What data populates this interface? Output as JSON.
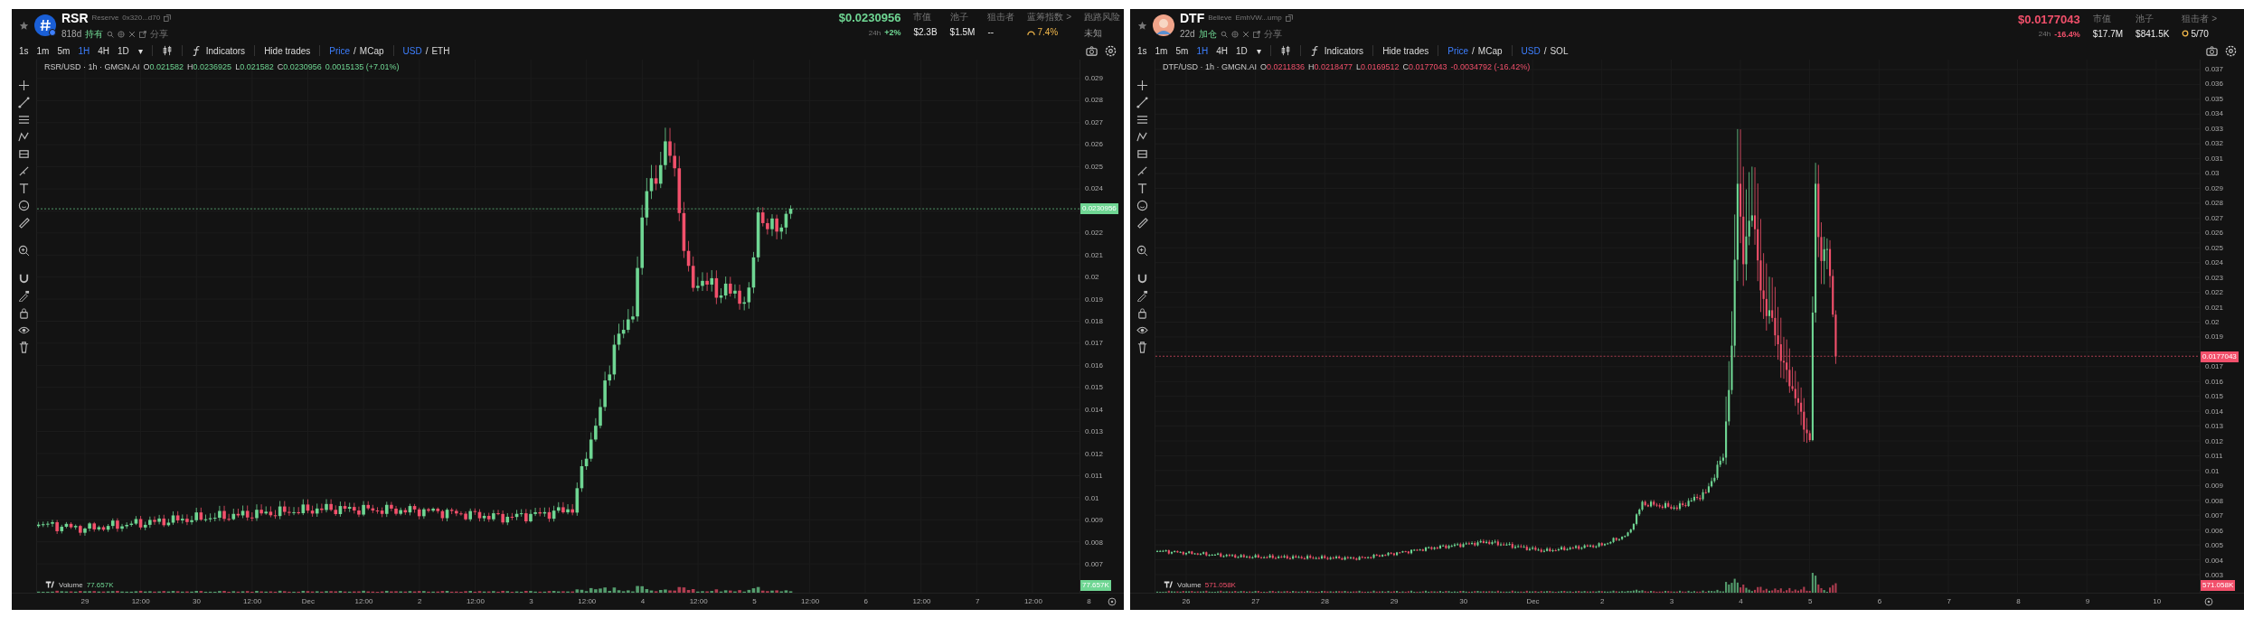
{
  "panels": [
    {
      "rising": true,
      "symbol": "RSR",
      "name": "Reserve",
      "address": "0x320...d70",
      "age": "818d",
      "holding": "持有",
      "share": "分享",
      "price": "$0.0230956",
      "change_label": "24h",
      "change": "+2%",
      "stats": [
        {
          "label": "市值",
          "value": "$2.3B"
        },
        {
          "label": "池子",
          "value": "$1.5M"
        },
        {
          "label": "狙击者",
          "value": "--"
        },
        {
          "label": "蓝筹指数 >",
          "value": "7.4%"
        },
        {
          "label": "跑路风险",
          "value": "未知"
        }
      ],
      "intervals": [
        {
          "label": "1s",
          "selected": false
        },
        {
          "label": "1m",
          "selected": false
        },
        {
          "label": "5m",
          "selected": false
        },
        {
          "label": "1H",
          "selected": true
        },
        {
          "label": "4H",
          "selected": false
        },
        {
          "label": "1D",
          "selected": false
        }
      ],
      "interval_more": "▾",
      "indicators": "Indicators",
      "hide_trades": "Hide trades",
      "price_mode": [
        {
          "label": "Price",
          "selected": true
        },
        {
          "label": "MCap",
          "selected": false
        }
      ],
      "price_divider": "/",
      "currency": [
        {
          "label": "USD",
          "selected": true
        },
        {
          "label": "ETH",
          "selected": false
        }
      ],
      "currency_divider": "/",
      "legend": {
        "title": "RSR/USD · 1h · GMGN.AI",
        "values": [
          {
            "label": "O",
            "value": "0.021582"
          },
          {
            "label": "H",
            "value": "0.0236925"
          },
          {
            "label": "L",
            "value": "0.021582"
          },
          {
            "label": "C",
            "value": "0.0230956"
          }
        ],
        "change": "0.0015135 (+7.01%)"
      },
      "y_ticks": [
        "0.029",
        "0.028",
        "0.027",
        "0.026",
        "0.025",
        "0.024",
        "0.022",
        "0.021",
        "0.02",
        "0.019",
        "0.018",
        "0.017",
        "0.016",
        "0.015",
        "0.014",
        "0.013",
        "0.012",
        "0.011",
        "0.01",
        "0.009",
        "0.008",
        "0.007"
      ],
      "price_tag": "0.0230956",
      "volume_label": "Volume",
      "volume": "77.657K",
      "volume_tag": "77.657K",
      "x_ticks": [
        "29",
        "12:00",
        "30",
        "12:00",
        "Dec",
        "12:00",
        "2",
        "12:00",
        "3",
        "12:00",
        "4",
        "12:00",
        "5",
        "12:00",
        "6",
        "12:00",
        "7",
        "12:00",
        "8"
      ]
    },
    {
      "rising": false,
      "symbol": "DTF",
      "name": "Believe",
      "address": "EmhVW...ump",
      "age": "22d",
      "holding": "加仓",
      "share": "分享",
      "price": "$0.0177043",
      "change_label": "24h",
      "change": "-16.4%",
      "stats": [
        {
          "label": "市值",
          "value": "$17.7M"
        },
        {
          "label": "池子",
          "value": "$841.5K"
        },
        {
          "label": "狙击者 >",
          "value": "5/70"
        }
      ],
      "intervals": [
        {
          "label": "1s",
          "selected": false
        },
        {
          "label": "1m",
          "selected": false
        },
        {
          "label": "5m",
          "selected": false
        },
        {
          "label": "1H",
          "selected": true
        },
        {
          "label": "4H",
          "selected": false
        },
        {
          "label": "1D",
          "selected": false
        }
      ],
      "interval_more": "▾",
      "indicators": "Indicators",
      "hide_trades": "Hide trades",
      "price_mode": [
        {
          "label": "Price",
          "selected": true
        },
        {
          "label": "MCap",
          "selected": false
        }
      ],
      "price_divider": "/",
      "currency": [
        {
          "label": "USD",
          "selected": true
        },
        {
          "label": "SOL",
          "selected": false
        }
      ],
      "currency_divider": "/",
      "legend": {
        "title": "DTF/USD · 1h · GMGN.AI",
        "values": [
          {
            "label": "O",
            "value": "0.0211836"
          },
          {
            "label": "H",
            "value": "0.0218477"
          },
          {
            "label": "L",
            "value": "0.0169512"
          },
          {
            "label": "C",
            "value": "0.0177043"
          }
        ],
        "change": "-0.0034792 (-16.42%)"
      },
      "y_ticks": [
        "0.037",
        "0.036",
        "0.035",
        "0.034",
        "0.033",
        "0.032",
        "0.031",
        "0.03",
        "0.029",
        "0.028",
        "0.027",
        "0.026",
        "0.025",
        "0.024",
        "0.023",
        "0.022",
        "0.021",
        "0.02",
        "0.019",
        "0.017",
        "0.016",
        "0.015",
        "0.014",
        "0.013",
        "0.012",
        "0.011",
        "0.01",
        "0.009",
        "0.008",
        "0.007",
        "0.006",
        "0.005",
        "0.004",
        "0.003"
      ],
      "price_tag": "0.0177043",
      "volume_label": "Volume",
      "volume": "571.058K",
      "volume_tag": "571.058K",
      "x_ticks": [
        "26",
        "27",
        "28",
        "29",
        "30",
        "Dec",
        "2",
        "3",
        "4",
        "5",
        "6",
        "7",
        "8",
        "9",
        "10"
      ]
    }
  ]
}
